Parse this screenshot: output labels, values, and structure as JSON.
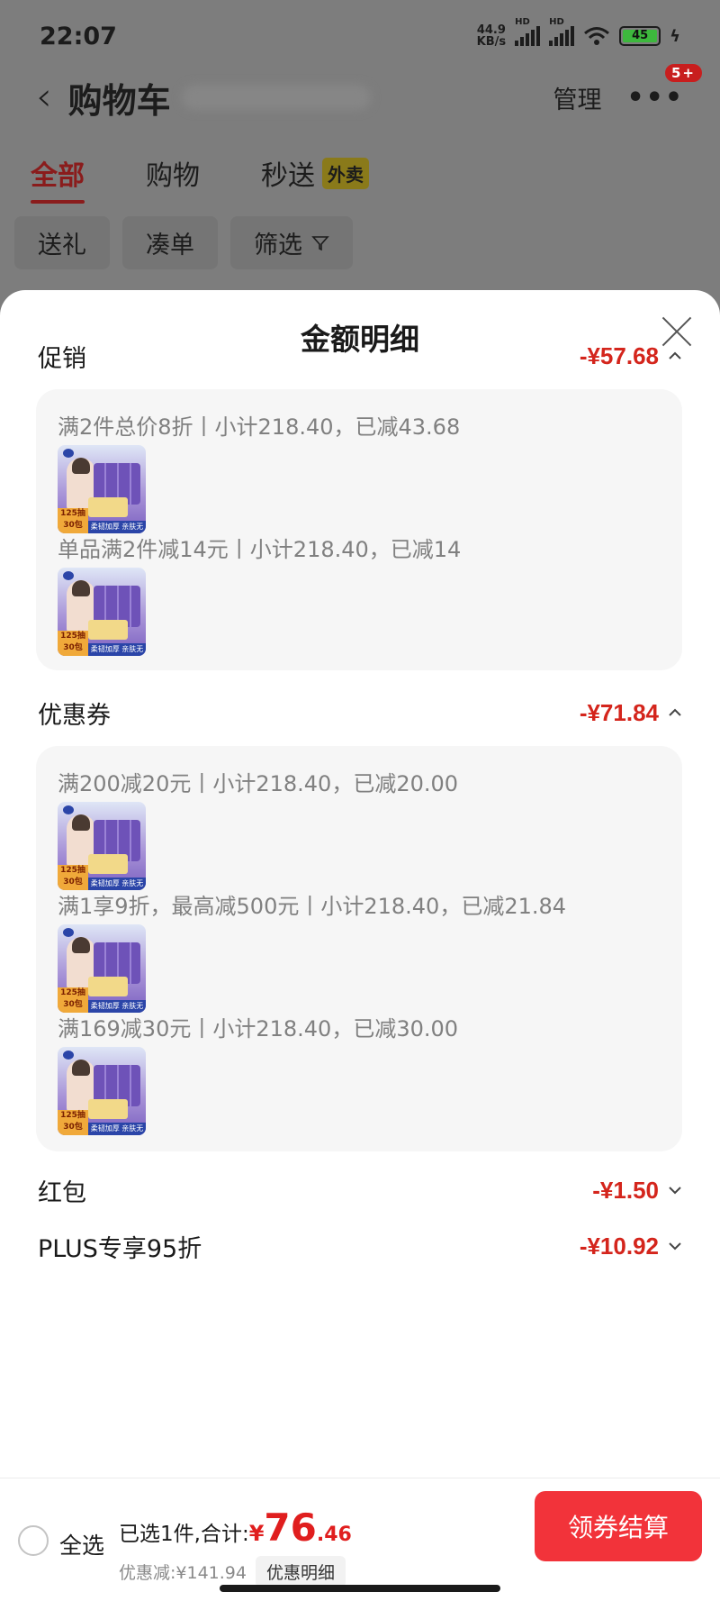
{
  "status_bar": {
    "time": "22:07",
    "net_speed": "44.9",
    "net_unit": "KB/s",
    "hd1": "HD",
    "hd2": "HD",
    "battery": "45"
  },
  "nav": {
    "title": "购物车",
    "manage": "管理",
    "more": "•••",
    "badge": "5+"
  },
  "tabs": [
    {
      "label": "全部"
    },
    {
      "label": "购物"
    },
    {
      "label": "秒送",
      "tag": "外卖"
    }
  ],
  "chips": [
    {
      "label": "送礼"
    },
    {
      "label": "凑单"
    },
    {
      "label": "筛选"
    }
  ],
  "sheet": {
    "title": "金额明细",
    "sections": [
      {
        "label": "促销",
        "amount": "-¥57.68"
      },
      {
        "label": "优惠券",
        "amount": "-¥71.84"
      },
      {
        "label": "红包",
        "amount": "-¥1.50"
      },
      {
        "label": "PLUS专享95折",
        "amount": "-¥10.92"
      }
    ],
    "promo_lines": [
      "满2件总价8折丨小计218.40，已减43.68",
      "单品满2件减14元丨小计218.40，已减14"
    ],
    "coupon_lines": [
      "满200减20元丨小计218.40，已减20.00",
      "满1享9折，最高减500元丨小计218.40，已减21.84",
      "满169减30元丨小计218.40，已减30.00"
    ],
    "product_badge": {
      "count_text": "125抽",
      "size_text": "30包",
      "strip_text": "柔韧加厚 亲肤无刺激"
    }
  },
  "bottom_bar": {
    "select_all": "全选",
    "total_label": "已选1件,合计:",
    "currency": "¥",
    "total_int": "76",
    "total_dec": ".46",
    "discount_label": "优惠减:¥141.94",
    "detail_button": "优惠明细",
    "checkout_button": "领券结算"
  },
  "colors": {
    "accent_red": "#d4251c",
    "checkout_red": "#f2333a",
    "card_bg": "#f6f6f6"
  }
}
